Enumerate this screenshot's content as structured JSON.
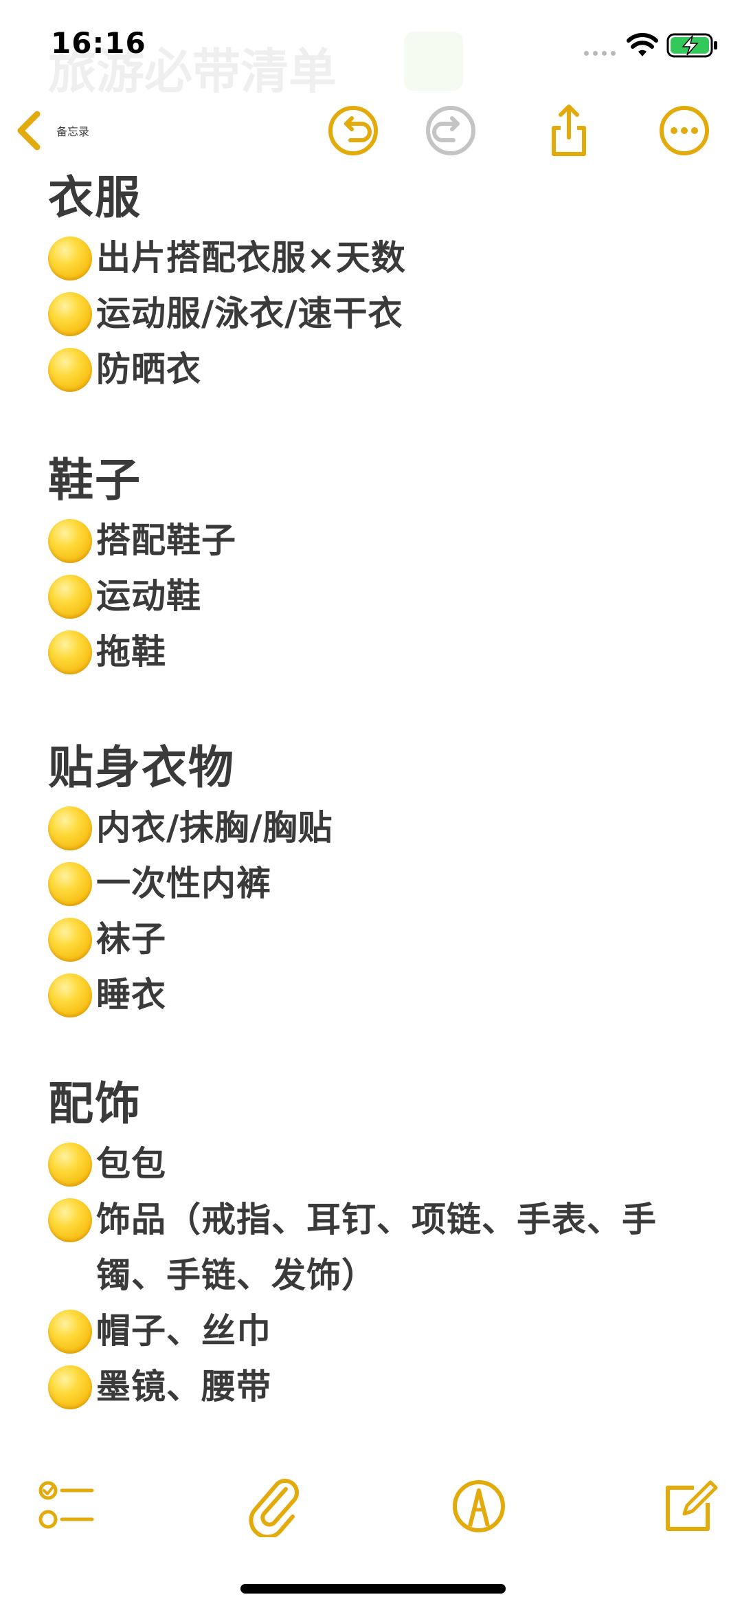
{
  "status_bar": {
    "time": "16:16",
    "ghost_title": "旅游必带清单"
  },
  "nav": {
    "back_label": "备忘录",
    "buttons": [
      "undo-icon",
      "redo-icon",
      "share-icon",
      "more-icon"
    ]
  },
  "colors": {
    "accent": "#e2aa0a",
    "text": "#3a3a3a",
    "disabled": "#c4c4c4",
    "battery_green": "#34c759"
  },
  "note": {
    "sections": [
      {
        "heading": "衣服",
        "items": [
          "出片搭配衣服×天数",
          "运动服/泳衣/速干衣",
          "防晒衣"
        ]
      },
      {
        "heading": "鞋子",
        "items": [
          "搭配鞋子",
          "运动鞋",
          "拖鞋"
        ]
      },
      {
        "heading": "贴身衣物",
        "items": [
          "内衣/抹胸/胸贴",
          "一次性内裤",
          "袜子",
          "睡衣"
        ]
      },
      {
        "heading": "配饰",
        "items": [
          "包包",
          "饰品（戒指、耳钉、项链、手表、手镯、手链、发饰）",
          "帽子、丝巾",
          "墨镜、腰带"
        ]
      }
    ]
  },
  "toolbar": {
    "buttons": [
      "checklist-icon",
      "attachment-icon",
      "markup-icon",
      "compose-icon"
    ]
  }
}
